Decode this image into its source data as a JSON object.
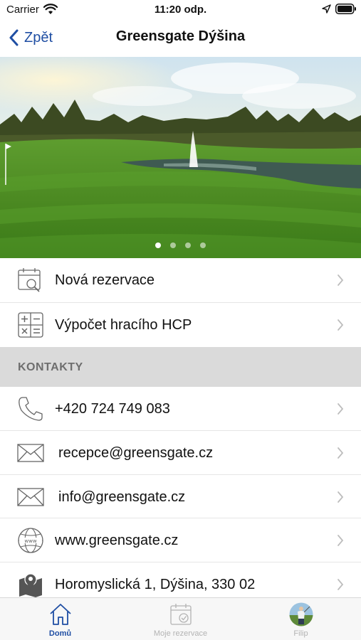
{
  "status_bar": {
    "carrier": "Carrier",
    "time": "11:20 odp."
  },
  "nav": {
    "back_label": "Zpět",
    "title": "Greensgate Dýšina"
  },
  "hero": {
    "page_count": 4,
    "active_page": 1
  },
  "actions": [
    {
      "label": "Nová rezervace",
      "icon": "calendar-search-icon"
    },
    {
      "label": "Výpočet hracího HCP",
      "icon": "calculator-icon"
    }
  ],
  "contacts_section": {
    "title": "KONTAKTY"
  },
  "contacts": [
    {
      "label": "+420 724 749 083",
      "icon": "phone-icon"
    },
    {
      "label": "recepce@greensgate.cz",
      "icon": "envelope-icon"
    },
    {
      "label": "info@greensgate.cz",
      "icon": "envelope-icon"
    },
    {
      "label": "www.greensgate.cz",
      "icon": "globe-icon"
    },
    {
      "label": "Horomyslická 1, Dýšina, 330 02",
      "icon": "map-pin-icon"
    }
  ],
  "tab_bar": {
    "tabs": [
      {
        "label": "Domů",
        "icon": "home-icon",
        "active": true
      },
      {
        "label": "Moje rezervace",
        "icon": "calendar-check-icon",
        "active": false
      },
      {
        "label": "Filip",
        "icon": "avatar",
        "active": false
      }
    ]
  },
  "colors": {
    "accent": "#1f4ea3",
    "section_bg": "#dadada",
    "inactive_tab": "#b3b3b3"
  }
}
